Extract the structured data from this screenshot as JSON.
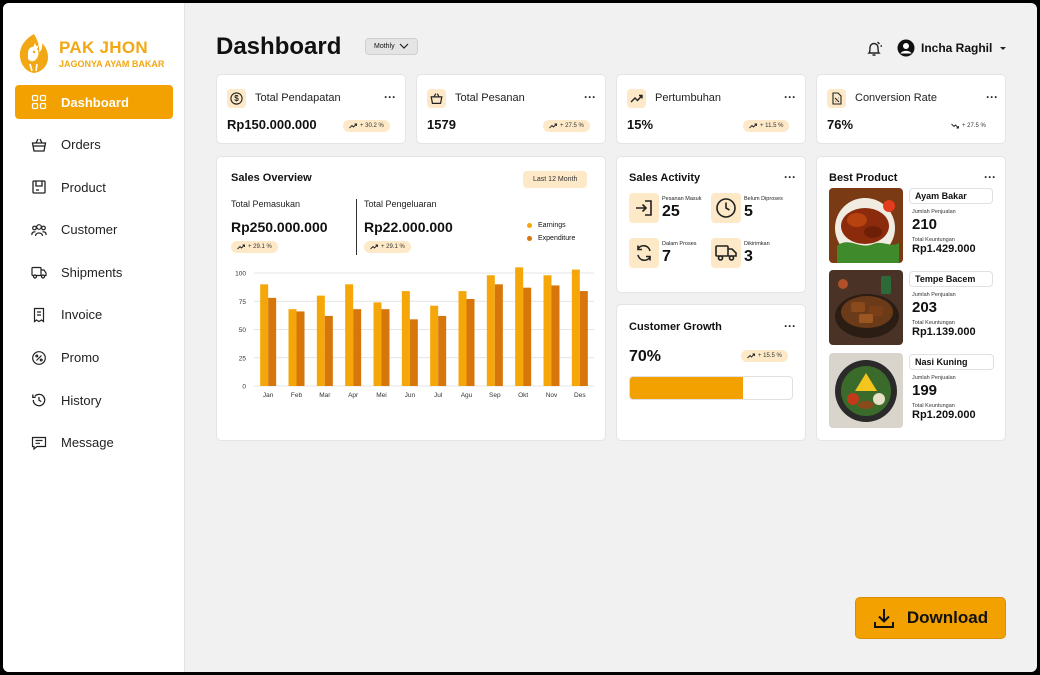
{
  "brand": {
    "title": "PAK JHON",
    "subtitle": "JAGONYA AYAM BAKAR"
  },
  "sidebar": {
    "items": [
      {
        "label": "Dashboard",
        "icon": "grid-icon",
        "active": true
      },
      {
        "label": "Orders",
        "icon": "basket-icon"
      },
      {
        "label": "Product",
        "icon": "box-icon"
      },
      {
        "label": "Customer",
        "icon": "users-icon"
      },
      {
        "label": "Shipments",
        "icon": "truck-icon"
      },
      {
        "label": "Invoice",
        "icon": "invoice-icon"
      },
      {
        "label": "Promo",
        "icon": "percent-icon"
      },
      {
        "label": "History",
        "icon": "history-icon"
      },
      {
        "label": "Message",
        "icon": "message-icon"
      }
    ]
  },
  "header": {
    "title": "Dashboard",
    "period": "Mothly",
    "user_name": "Incha Raghil"
  },
  "stats": [
    {
      "label": "Total Pendapatan",
      "value": "Rp150.000.000",
      "change": "+ 30.2 %",
      "icon": "dollar-icon"
    },
    {
      "label": "Total Pesanan",
      "value": "1579",
      "change": "+ 27.5 %",
      "icon": "basket-icon"
    },
    {
      "label": "Pertumbuhan",
      "value": "15%",
      "change": "+ 11.5 %",
      "icon": "trend-up-icon"
    },
    {
      "label": "Conversion Rate",
      "value": "76%",
      "change": "+ 27.5 %",
      "icon": "conversion-icon"
    }
  ],
  "sales_overview": {
    "title": "Sales Overview",
    "range": "Last 12 Month",
    "income_label": "Total Pemasukan",
    "income_value": "Rp250.000.000",
    "income_change": "+ 29.1 %",
    "expense_label": "Total Pengeluaran",
    "expense_value": "Rp22.000.000",
    "expense_change": "+ 29.1 %"
  },
  "chart_data": {
    "type": "bar",
    "categories": [
      "Jan",
      "Feb",
      "Mar",
      "Apr",
      "Mei",
      "Jun",
      "Jul",
      "Agu",
      "Sep",
      "Okt",
      "Nov",
      "Des"
    ],
    "series": [
      {
        "name": "Earnings",
        "color": "#f5a70a",
        "values": [
          90,
          68,
          80,
          90,
          74,
          84,
          71,
          84,
          98,
          105,
          98,
          103
        ]
      },
      {
        "name": "Expenditure",
        "color": "#d7760a",
        "values": [
          78,
          66,
          62,
          68,
          68,
          59,
          62,
          77,
          90,
          87,
          89,
          84
        ]
      }
    ],
    "yticks": [
      0,
      25,
      50,
      75,
      100
    ],
    "ylim": [
      0,
      100
    ],
    "grid": true,
    "legend": "top-right"
  },
  "sales_activity": {
    "title": "Sales Activity",
    "items": [
      {
        "label": "Pesanan Masuk",
        "value": "25",
        "icon": "login-icon"
      },
      {
        "label": "Belum Diproses",
        "value": "5",
        "icon": "clock-icon"
      },
      {
        "label": "Dalam Proses",
        "value": "7",
        "icon": "refresh-icon"
      },
      {
        "label": "Dikirimkan",
        "value": "3",
        "icon": "truck-icon"
      }
    ]
  },
  "customer_growth": {
    "title": "Customer Growth",
    "value": "70%",
    "change": "+ 15.5 %",
    "progress": 0.7
  },
  "best_product": {
    "title": "Best Product",
    "qty_caption": "Jumlah Penjualan",
    "revenue_caption": "Total Keuntungan",
    "items": [
      {
        "name": "Ayam Bakar",
        "qty": "210",
        "revenue": "Rp1.429.000"
      },
      {
        "name": "Tempe Bacem",
        "qty": "203",
        "revenue": "Rp1.139.000"
      },
      {
        "name": "Nasi Kuning",
        "qty": "199",
        "revenue": "Rp1.209.000"
      }
    ]
  },
  "actions": {
    "download_label": "Download"
  },
  "colors": {
    "accent": "#f2a100",
    "accent_soft": "#fde9c7",
    "expenditure": "#d7760a"
  }
}
